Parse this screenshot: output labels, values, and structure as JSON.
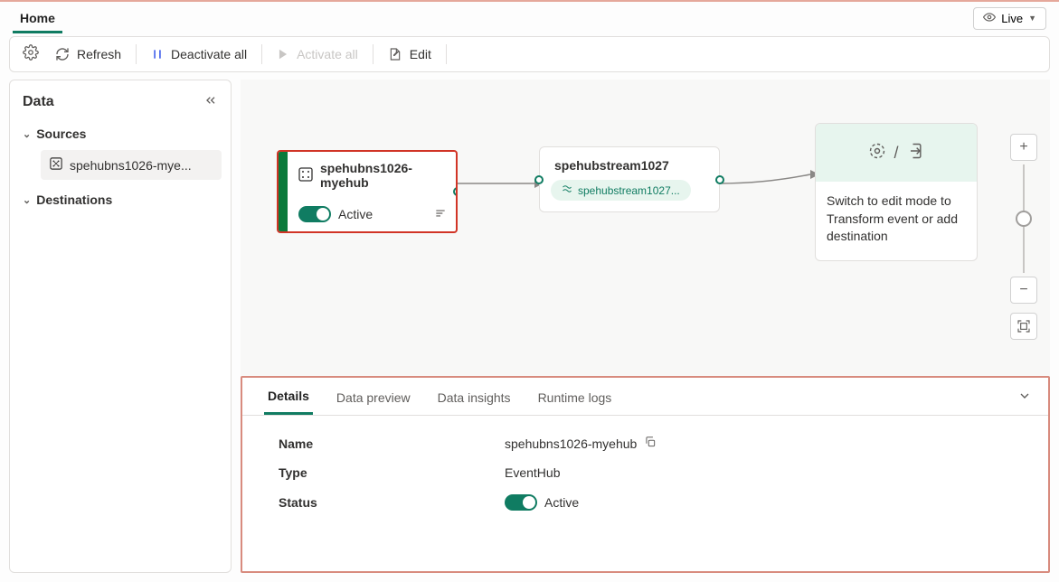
{
  "header": {
    "tab": "Home",
    "live": "Live"
  },
  "toolbar": {
    "refresh": "Refresh",
    "deactivate": "Deactivate all",
    "activate": "Activate all",
    "edit": "Edit"
  },
  "sidebar": {
    "title": "Data",
    "sources_label": "Sources",
    "destinations_label": "Destinations",
    "source_item": "spehubns1026-mye..."
  },
  "canvas": {
    "source_node": {
      "title": "spehubns1026-myehub",
      "status": "Active"
    },
    "stream_node": {
      "title": "spehubstream1027",
      "pill": "spehubstream1027..."
    },
    "dest_text": "Switch to edit mode to Transform event or add destination"
  },
  "bottom": {
    "tabs": {
      "details": "Details",
      "preview": "Data preview",
      "insights": "Data insights",
      "logs": "Runtime logs"
    },
    "labels": {
      "name": "Name",
      "type": "Type",
      "status": "Status"
    },
    "name": "spehubns1026-myehub",
    "type": "EventHub",
    "status": "Active"
  }
}
